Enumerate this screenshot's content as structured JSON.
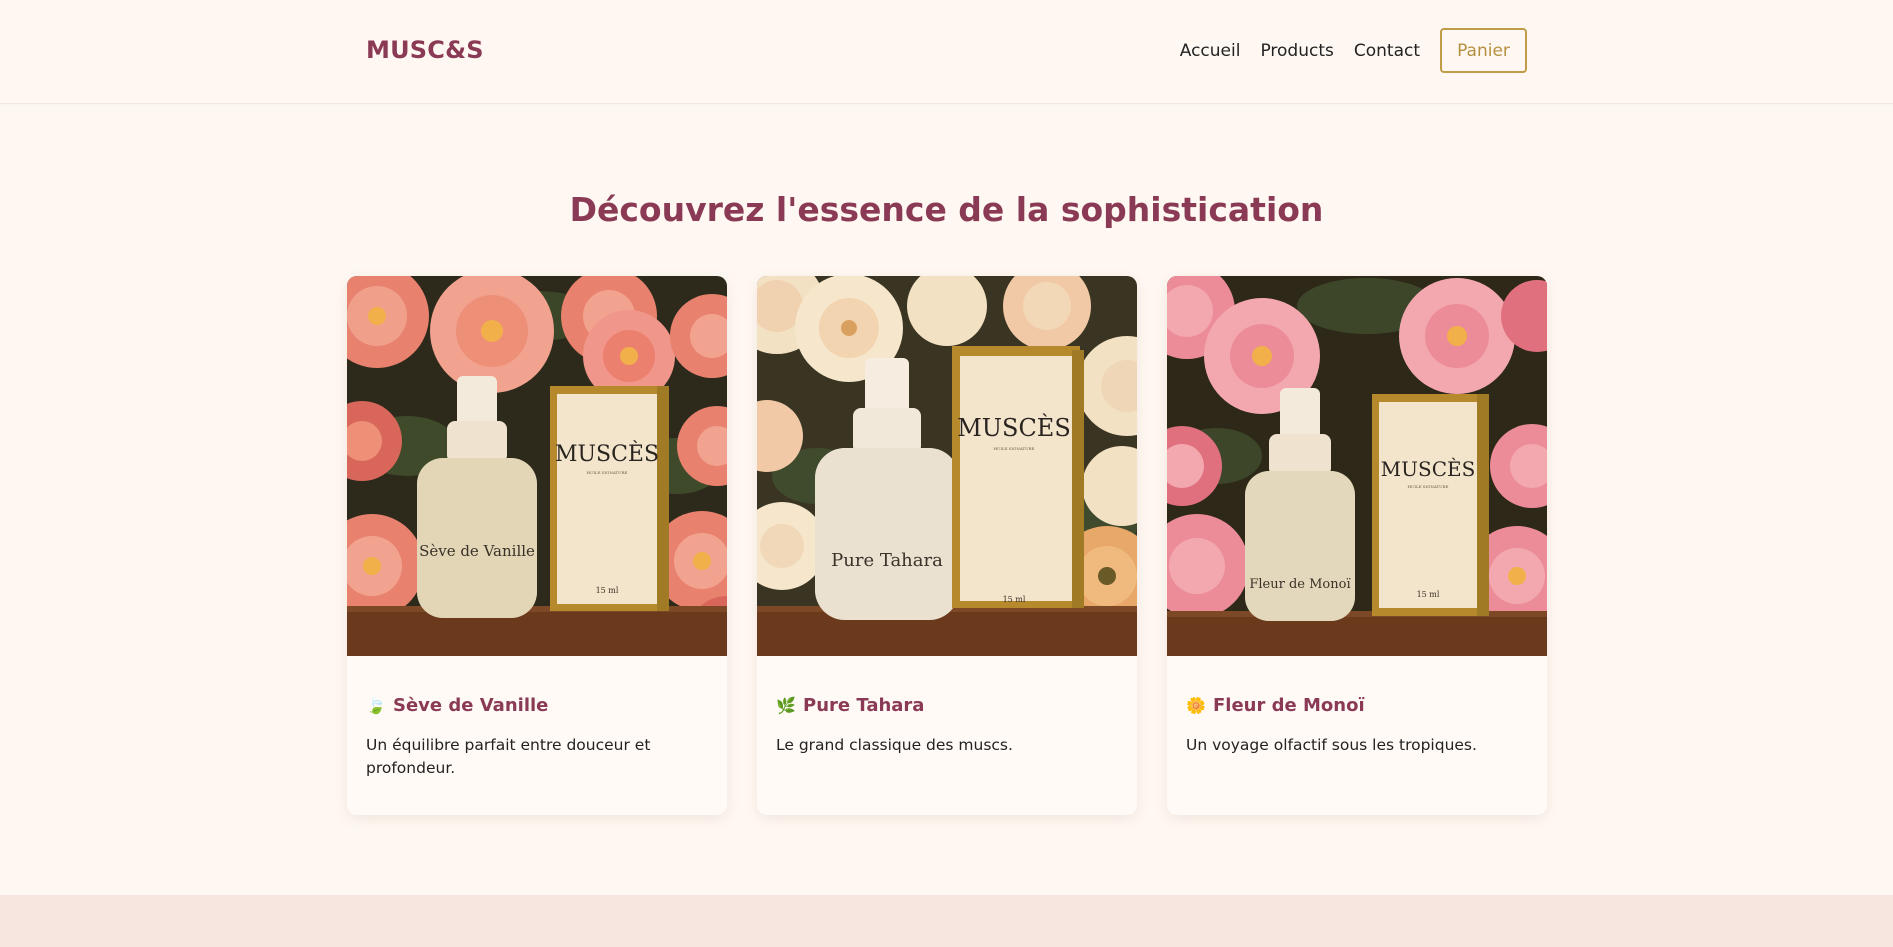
{
  "header": {
    "logo": "MUSC&S",
    "nav": [
      "Accueil",
      "Products",
      "Contact"
    ],
    "cart_label": "Panier"
  },
  "hero": {
    "title": "Découvrez l'essence de la sophistication"
  },
  "products": [
    {
      "name": "Sève de Vanille",
      "emoji": "🍃",
      "description": "Un équilibre parfait entre douceur et profondeur.",
      "image": {
        "bottle_label": "Sève de Vanille",
        "box_brand": "MUSCÈS",
        "box_subtitle": "HUILE SIGNATURE",
        "box_volume": "15 ml",
        "flower_colors": [
          "#e8826e",
          "#f2a38f",
          "#d8665a"
        ],
        "background": "#2d2a1c"
      }
    },
    {
      "name": "Pure Tahara",
      "emoji": "🌿",
      "description": "Le grand classique des muscs.",
      "image": {
        "bottle_label": "Pure Tahara",
        "box_brand": "MUSCÈS",
        "box_subtitle": "HUILE SIGNATURE",
        "box_volume": "15 ml",
        "flower_colors": [
          "#f3e1c4",
          "#f2c9a6",
          "#e8a86a"
        ],
        "background": "#3a3522"
      }
    },
    {
      "name": "Fleur de Monoï",
      "emoji": "🌼",
      "description": "Un voyage olfactif sous les tropiques.",
      "image": {
        "bottle_label": "Fleur de Monoï",
        "box_brand": "MUSCÈS",
        "box_subtitle": "HUILE SIGNATURE",
        "box_volume": "15 ml",
        "flower_colors": [
          "#ec8c98",
          "#f3a8b0",
          "#e0707e"
        ],
        "background": "#2e2818"
      }
    }
  ],
  "colors": {
    "brand": "#8a3a55",
    "gold": "#c09c49",
    "page_bg": "#fff8f2",
    "footer_bg": "#f7e6e0"
  }
}
